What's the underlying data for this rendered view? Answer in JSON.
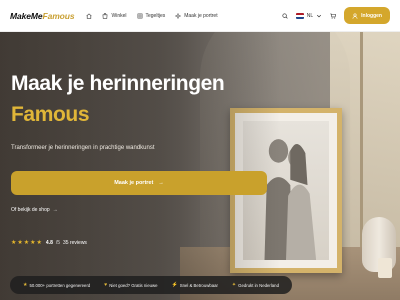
{
  "nav": {
    "logo_part1": "MakeMe",
    "logo_part2": "Famous",
    "links": [
      {
        "label": "",
        "icon": "home-icon"
      },
      {
        "label": "Winkel",
        "icon": "store-icon"
      },
      {
        "label": "Tegeltjes",
        "icon": "tile-icon"
      },
      {
        "label": "Maak je portret",
        "icon": "sparkle-icon"
      }
    ],
    "language": "NL",
    "login_label": "Inloggen"
  },
  "hero": {
    "title_line1": "Maak je herinneringen",
    "title_line2": "Famous",
    "subtitle": "Transformeer je herinneringen in prachtige wandkunst",
    "cta_label": "Maak je portret",
    "cta_arrow": "→",
    "shop_link": "Of bekijk de shop",
    "shop_arrow": "→",
    "rating": {
      "stars": "★★★★★",
      "score": "4.8",
      "out_of": "/5",
      "reviews": "35 reviews"
    }
  },
  "badges": [
    {
      "icon": "★",
      "label": "50.000+ portretten gegenereerd"
    },
    {
      "icon": "♥",
      "label": "Niet goed? Gratis nieuwe"
    },
    {
      "icon": "⚡",
      "label": "Snel & Betrouwbaar"
    },
    {
      "icon": "✦",
      "label": "Gedrukt in Nederland"
    }
  ],
  "colors": {
    "accent": "#d4a72c",
    "accent_text": "#e0b638",
    "badge_bar": "#1e1e1e"
  }
}
